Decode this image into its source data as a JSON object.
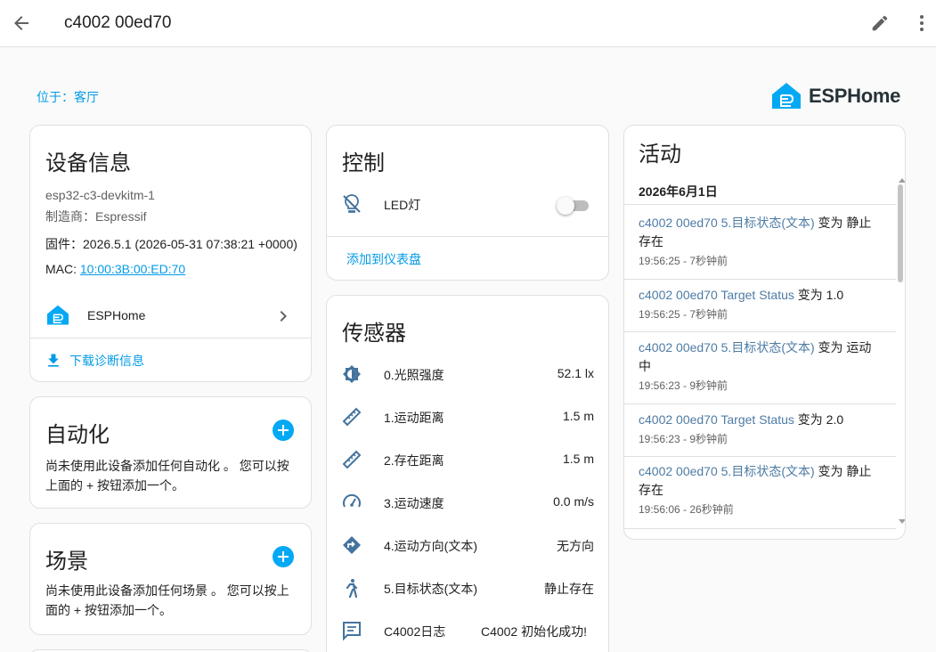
{
  "header": {
    "title": "c4002 00ed70"
  },
  "location": "位于：客厅",
  "brand": {
    "name": "ESPHome",
    "color": "#03a9f4"
  },
  "device_info": {
    "title": "设备信息",
    "model": "esp32-c3-devkitm-1",
    "manufacturer": "制造商：Espressif",
    "firmware": "固件：2026.5.1 (2026-05-31 07:38:21 +0000)",
    "mac_label": "MAC: ",
    "mac_value": "10:00:3B:00:ED:70",
    "integration": "ESPHome",
    "download": "下载诊断信息"
  },
  "automation": {
    "title": "自动化",
    "description_line1": "尚未使用此设备添加任何自动化 。 您可以按",
    "description_line2": "上面的 + 按钮添加一个。"
  },
  "scene": {
    "title": "场景",
    "description_line1": "尚未使用此设备添加任何场景 。 您可以按上",
    "description_line2": "面的 + 按钮添加一个。"
  },
  "controls": {
    "title": "控制",
    "led_label": "LED灯",
    "led_state": "off",
    "add_dashboard": "添加到仪表盘"
  },
  "sensors": {
    "title": "传感器",
    "items": [
      {
        "label": "0.光照强度",
        "value": "52.1 lx",
        "icon": "brightness-icon"
      },
      {
        "label": "1.运动距离",
        "value": "1.5 m",
        "icon": "ruler-icon"
      },
      {
        "label": "2.存在距离",
        "value": "1.5 m",
        "icon": "ruler-icon"
      },
      {
        "label": "3.运动速度",
        "value": "0.0 m/s",
        "icon": "speedometer-icon"
      },
      {
        "label": "4.运动方向(文本)",
        "value": "无方向",
        "icon": "direction-icon"
      },
      {
        "label": "5.目标状态(文本)",
        "value": "静止存在",
        "icon": "person-walking-icon"
      },
      {
        "label": "C4002日志",
        "value": "C4002 初始化成功!",
        "icon": "message-icon"
      }
    ]
  },
  "activity": {
    "title": "活动",
    "date": "2026年6月1日",
    "entries": [
      {
        "entity": "c4002 00ed70 5.目标状态(文本)",
        "action": " 变为 静止存在",
        "time": "19:56:25 - 7秒钟前"
      },
      {
        "entity": "c4002 00ed70 Target Status",
        "action": " 变为 1.0",
        "time": "19:56:25 - 7秒钟前"
      },
      {
        "entity": "c4002 00ed70 5.目标状态(文本)",
        "action": " 变为 运动中",
        "time": "19:56:23 - 9秒钟前"
      },
      {
        "entity": "c4002 00ed70 Target Status",
        "action": " 变为 2.0",
        "time": "19:56:23 - 9秒钟前"
      },
      {
        "entity": "c4002 00ed70 5.目标状态(文本)",
        "action": " 变为 静止存在",
        "time": "19:56:06 - 26秒钟前"
      }
    ]
  },
  "colors": {
    "accent": "#03a9f4",
    "link": "#039be5",
    "entity_link": "#4e7ca4",
    "icon": "#44739e"
  }
}
